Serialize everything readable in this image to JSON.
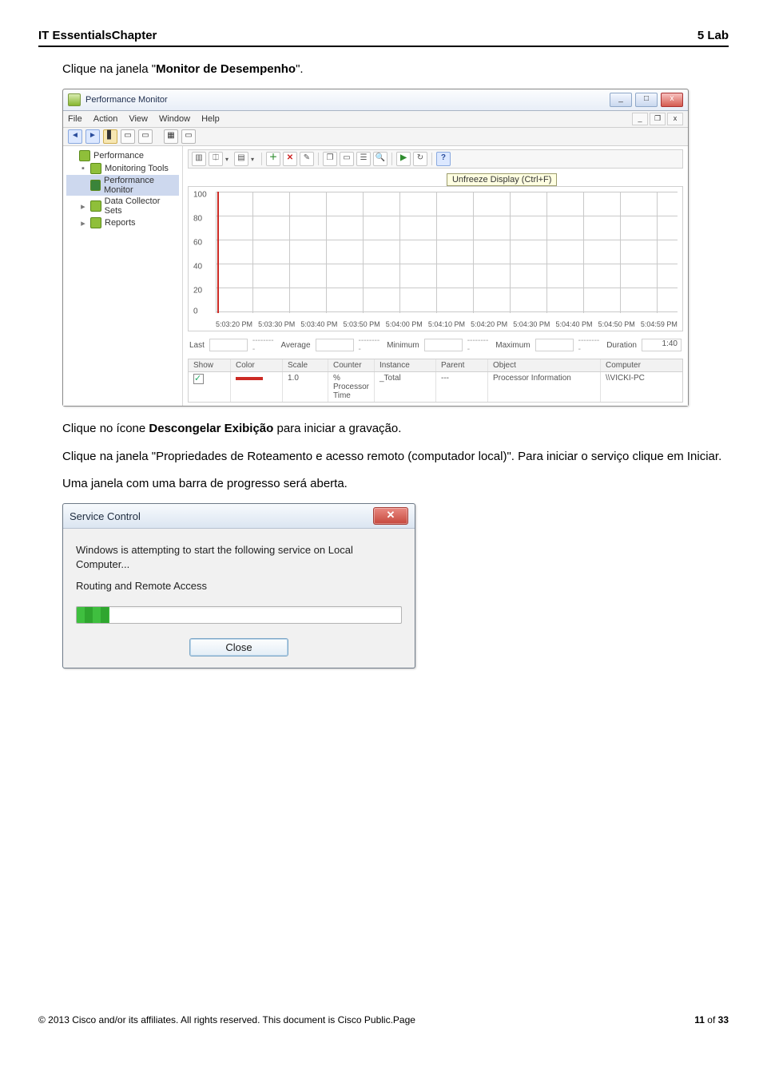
{
  "header": {
    "left": "IT EssentialsChapter",
    "right": "5 Lab"
  },
  "paragraphs": {
    "p1a": "Clique na janela \"",
    "p1b": "Monitor de Desempenho",
    "p1c": "\".",
    "p2a": "Clique no ícone ",
    "p2b": "Descongelar Exibição",
    "p2c": " para iniciar a gravação.",
    "p3": "Clique na janela \"Propriedades de Roteamento e acesso remoto (computador local)\". Para iniciar o serviço clique em Iniciar.",
    "p4": "Uma janela com uma barra de progresso será aberta."
  },
  "perfmon": {
    "title": "Performance Monitor",
    "winbtns": {
      "min": "_",
      "max": "□",
      "close": "x"
    },
    "menu": [
      "File",
      "Action",
      "View",
      "Window",
      "Help"
    ],
    "mdi": {
      "min": "_",
      "restore": "❐",
      "close": "x"
    },
    "tree": [
      {
        "label": "Performance",
        "expander": "",
        "indent": 0
      },
      {
        "label": "Monitoring Tools",
        "expander": "▪",
        "indent": 1
      },
      {
        "label": "Performance Monitor",
        "expander": "",
        "indent": 2,
        "selected": true
      },
      {
        "label": "Data Collector Sets",
        "expander": "▸",
        "indent": 1
      },
      {
        "label": "Reports",
        "expander": "▸",
        "indent": 1
      }
    ],
    "tooltip": "Unfreeze Display (Ctrl+F)",
    "chart_data": {
      "type": "line",
      "ylim": [
        0,
        100
      ],
      "y_ticks": [
        100,
        80,
        60,
        40,
        20,
        0
      ],
      "x_ticks": [
        "5:03:20 PM",
        "5:03:30 PM",
        "5:03:40 PM",
        "5:03:50 PM",
        "5:04:00 PM",
        "5:04:10 PM",
        "5:04:20 PM",
        "5:04:30 PM",
        "5:04:40 PM",
        "5:04:50 PM",
        "5:04:59 PM"
      ],
      "series": [
        {
          "name": "% Processor Time",
          "values": []
        }
      ]
    },
    "stats": {
      "last_lbl": "Last",
      "avg_lbl": "Average",
      "min_lbl": "Minimum",
      "max_lbl": "Maximum",
      "dur_lbl": "Duration",
      "dur_val": "1:40",
      "placeholder": "---------"
    },
    "table": {
      "headers": {
        "show": "Show",
        "color": "Color",
        "scale": "Scale",
        "counter": "Counter",
        "instance": "Instance",
        "parent": "Parent",
        "object": "Object",
        "computer": "Computer"
      },
      "row": {
        "scale": "1.0",
        "counter": "% Processor Time",
        "instance": "_Total",
        "parent": "---",
        "object": "Processor Information",
        "computer": "\\\\VICKI-PC"
      }
    }
  },
  "service_control": {
    "title": "Service Control",
    "line1": "Windows is attempting to start the following service on Local Computer...",
    "line2": "Routing and Remote Access",
    "close": "Close"
  },
  "footer": {
    "left": "© 2013 Cisco and/or its affiliates. All rights reserved. This document is Cisco Public.Page",
    "right_a": "11",
    "right_b": " of ",
    "right_c": "33"
  }
}
